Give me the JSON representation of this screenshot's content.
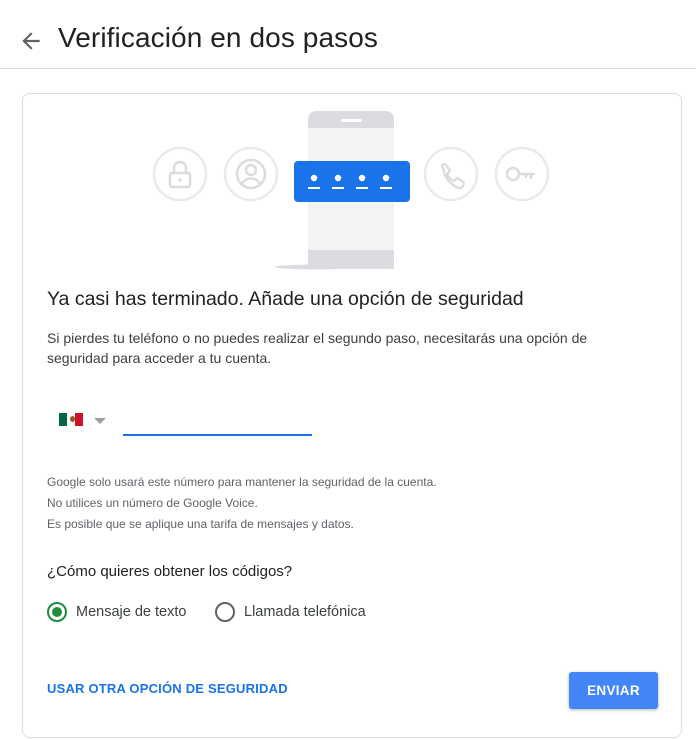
{
  "header": {
    "title": "Verificación en dos pasos"
  },
  "illustration": {
    "icons": [
      "lock-icon",
      "account-circle-icon",
      "password-dots-icon",
      "phone-icon",
      "key-icon"
    ]
  },
  "card": {
    "title": "Ya casi has terminado. Añade una opción de seguridad",
    "description": "Si pierdes tu teléfono o no puedes realizar el segundo paso, necesitarás una opción de seguridad para acceder a tu cuenta."
  },
  "phone": {
    "country_flag": "mexico-flag-icon",
    "value": "",
    "colors": {
      "underline": "#1a73e8"
    }
  },
  "notes": [
    "Google solo usará este número para mantener la seguridad de la cuenta.",
    "No utilices un número de Google Voice.",
    "Es posible que se aplique una tarifa de mensajes y datos."
  ],
  "method": {
    "question": "¿Cómo quieres obtener los códigos?",
    "options": [
      {
        "label": "Mensaje de texto",
        "selected": true
      },
      {
        "label": "Llamada telefónica",
        "selected": false
      }
    ]
  },
  "actions": {
    "alternate_label": "USAR OTRA OPCIÓN DE SEGURIDAD",
    "send_label": "ENVIAR"
  },
  "colors": {
    "accent": "#1a73e8",
    "button": "#4285f4",
    "radio_selected": "#1e8e3e"
  }
}
